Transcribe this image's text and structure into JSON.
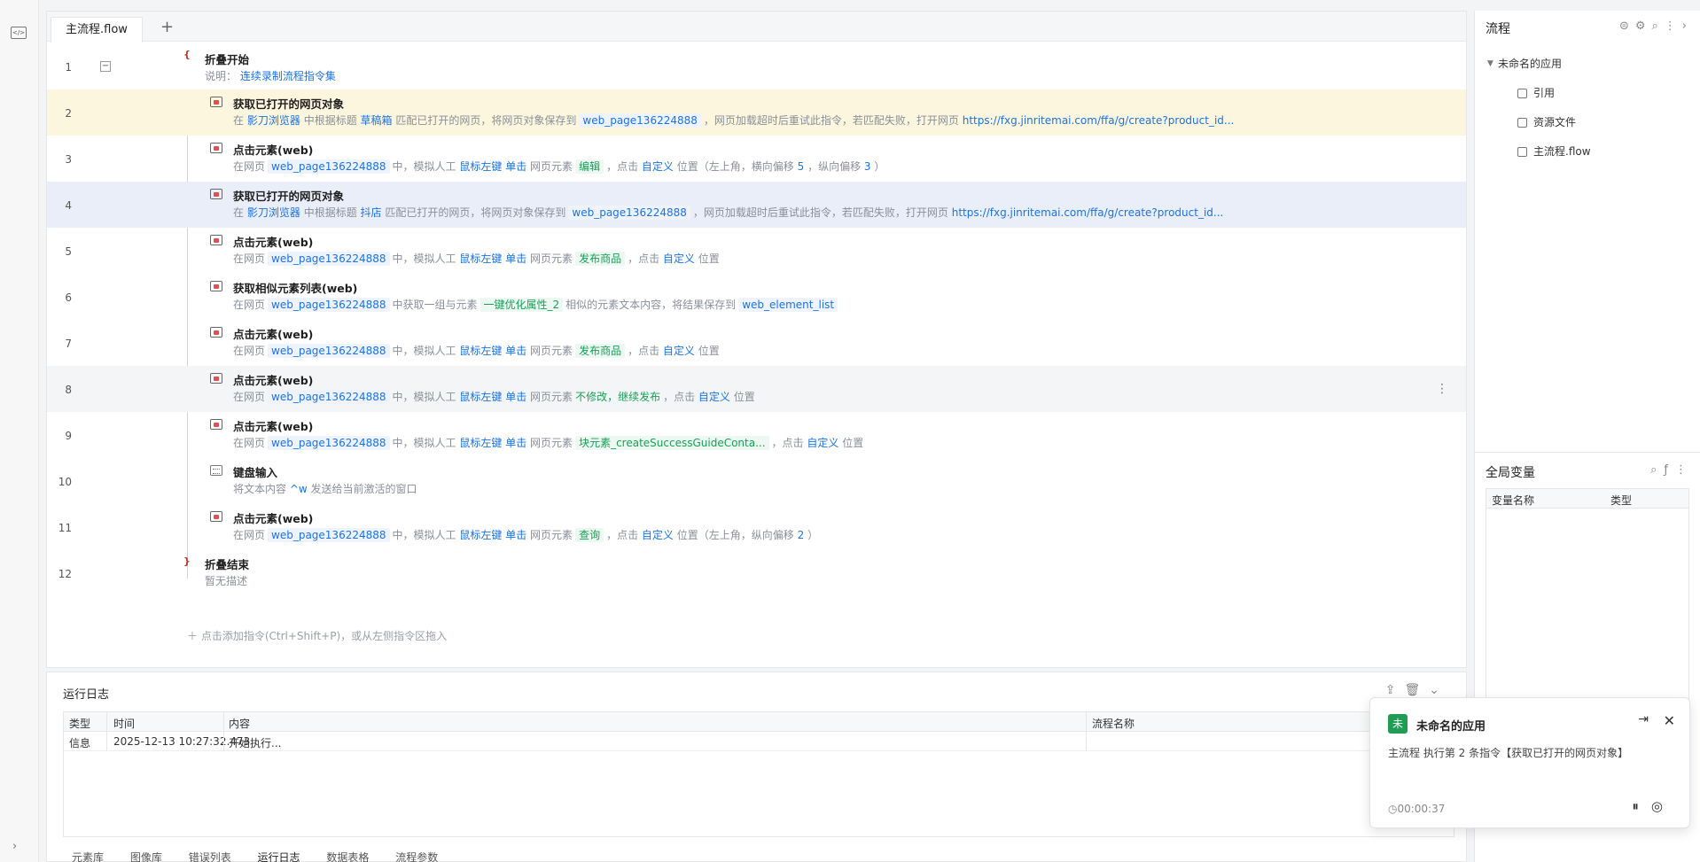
{
  "editor": {
    "tab_label": "主流程.flow",
    "add_tab": "+",
    "add_command_hint": "＋ 点击添加指令(Ctrl+Shift+P)，或从左侧指令区拖入",
    "rows": [
      {
        "no": "1",
        "title": "折叠开始",
        "desc_prefix": "说明：",
        "desc_link": "连续录制流程指令集"
      },
      {
        "no": "2",
        "title": "获取已打开的网页对象",
        "p1": "在",
        "browser": "影刀浏览器",
        "p2": "中根据标题",
        "match": "草稿箱",
        "p3": "匹配已打开的网页，将网页对象保存到",
        "var": "web_page136224888",
        "p4": "，网页加载超时后重试此指令，若匹配失败，打开网页",
        "url": "https://fxg.jinritemai.com/ffa/g/create?product_id..."
      },
      {
        "no": "3",
        "title": "点击元素(web)",
        "p1": "在网页",
        "var": "web_page136224888",
        "p2": "中，模拟人工",
        "mouse": "鼠标左键",
        "click": "单击",
        "p3": "网页元素",
        "el": "编辑",
        "p4": "，点击",
        "pos": "自定义",
        "p5": "位置（左上角，横向偏移",
        "x": "5",
        "p6": "，纵向偏移",
        "y": "3",
        "p7": "）"
      },
      {
        "no": "4",
        "title": "获取已打开的网页对象",
        "p1": "在",
        "browser": "影刀浏览器",
        "p2": "中根据标题",
        "match": "抖店",
        "p3": "匹配已打开的网页，将网页对象保存到",
        "var": "web_page136224888",
        "p4": "，网页加载超时后重试此指令，若匹配失败，打开网页",
        "url": "https://fxg.jinritemai.com/ffa/g/create?product_id..."
      },
      {
        "no": "5",
        "title": "点击元素(web)",
        "p1": "在网页",
        "var": "web_page136224888",
        "p2": "中，模拟人工",
        "mouse": "鼠标左键",
        "click": "单击",
        "p3": "网页元素",
        "el": "发布商品",
        "p4": "，点击",
        "pos": "自定义",
        "p5": "位置"
      },
      {
        "no": "6",
        "title": "获取相似元素列表(web)",
        "p1": "在网页",
        "var": "web_page136224888",
        "p2": "中获取一组与元素",
        "el": "一键优化属性_2",
        "p3": "相似的元素文本内容，将结果保存到",
        "out": "web_element_list"
      },
      {
        "no": "7",
        "title": "点击元素(web)",
        "p1": "在网页",
        "var": "web_page136224888",
        "p2": "中，模拟人工",
        "mouse": "鼠标左键",
        "click": "单击",
        "p3": "网页元素",
        "el": "发布商品",
        "p4": "，点击",
        "pos": "自定义",
        "p5": "位置"
      },
      {
        "no": "8",
        "title": "点击元素(web)",
        "p1": "在网页",
        "var": "web_page136224888",
        "p2": "中，模拟人工",
        "mouse": "鼠标左键",
        "click": "单击",
        "p3": "网页元素",
        "el": "不修改，继续发布",
        "p4": "，点击",
        "pos": "自定义",
        "p5": "位置"
      },
      {
        "no": "9",
        "title": "点击元素(web)",
        "p1": "在网页",
        "var": "web_page136224888",
        "p2": "中，模拟人工",
        "mouse": "鼠标左键",
        "click": "单击",
        "p3": "网页元素",
        "el": "块元素_createSuccessGuideConta...",
        "p4": "，点击",
        "pos": "自定义",
        "p5": "位置"
      },
      {
        "no": "10",
        "title": "键盘输入",
        "p1": "将文本内容",
        "key": "^w",
        "p2": "发送给当前激活的窗口"
      },
      {
        "no": "11",
        "title": "点击元素(web)",
        "p1": "在网页",
        "var": "web_page136224888",
        "p2": "中，模拟人工",
        "mouse": "鼠标左键",
        "click": "单击",
        "p3": "网页元素",
        "el": "查询",
        "p4": "，点击",
        "pos": "自定义",
        "p5": "位置（左上角，纵向偏移",
        "y": "2",
        "p7": "）"
      },
      {
        "no": "12",
        "title": "折叠结束",
        "desc": "暂无描述"
      }
    ]
  },
  "log": {
    "title": "运行日志",
    "headers": [
      "类型",
      "时间",
      "内容",
      "流程名称"
    ],
    "row": {
      "type": "信息",
      "time": "2025-12-13 10:27:32.473",
      "content": "开始执行..."
    },
    "tabs": [
      "元素库",
      "图像库",
      "错误列表",
      "运行日志",
      "数据表格",
      "流程参数"
    ]
  },
  "right": {
    "title": "流程",
    "tree_root": "未命名的应用",
    "tree_items": [
      "引用",
      "资源文件",
      "主流程.flow"
    ],
    "globals_title": "全局变量",
    "globals_headers": [
      "变量名称",
      "类型"
    ]
  },
  "toast": {
    "badge": "未",
    "title": "未命名的应用",
    "message": "主流程 执行第 2 条指令【获取已打开的网页对象】",
    "elapsed": "◷00:00:37"
  }
}
